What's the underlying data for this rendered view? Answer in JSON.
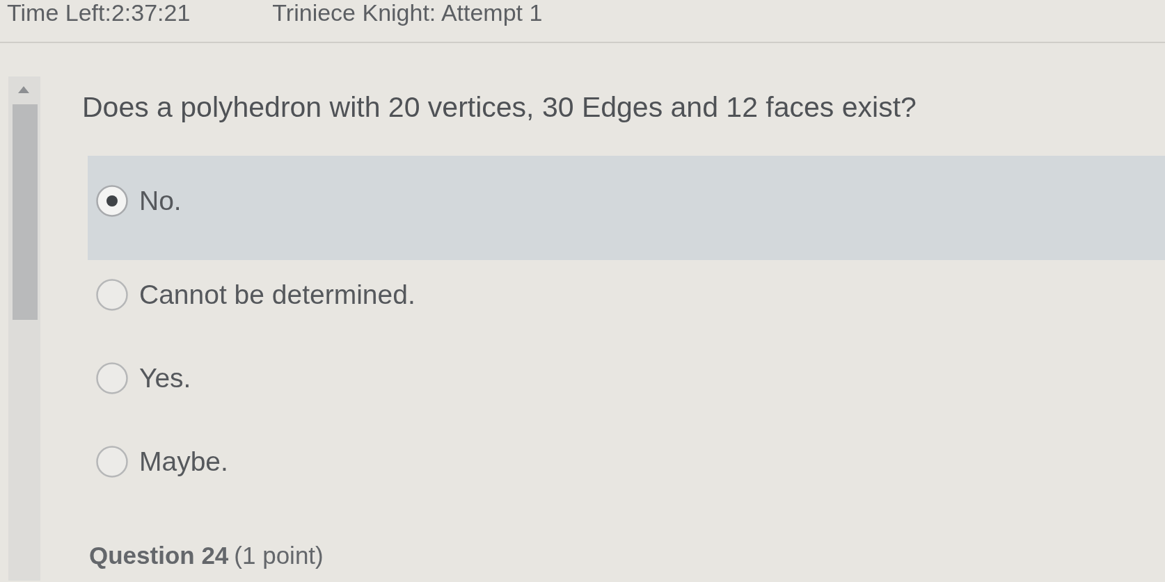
{
  "header": {
    "time_left": "Time Left:2:37:21",
    "attempt": "Triniece Knight: Attempt 1"
  },
  "question": {
    "text": "Does a polyhedron with 20 vertices, 30 Edges and 12 faces exist?",
    "options": [
      {
        "label": "No.",
        "selected": true
      },
      {
        "label": "Cannot be determined.",
        "selected": false
      },
      {
        "label": "Yes.",
        "selected": false
      },
      {
        "label": "Maybe.",
        "selected": false
      }
    ]
  },
  "next_question": {
    "title": "Question 24",
    "points": "(1 point)"
  }
}
